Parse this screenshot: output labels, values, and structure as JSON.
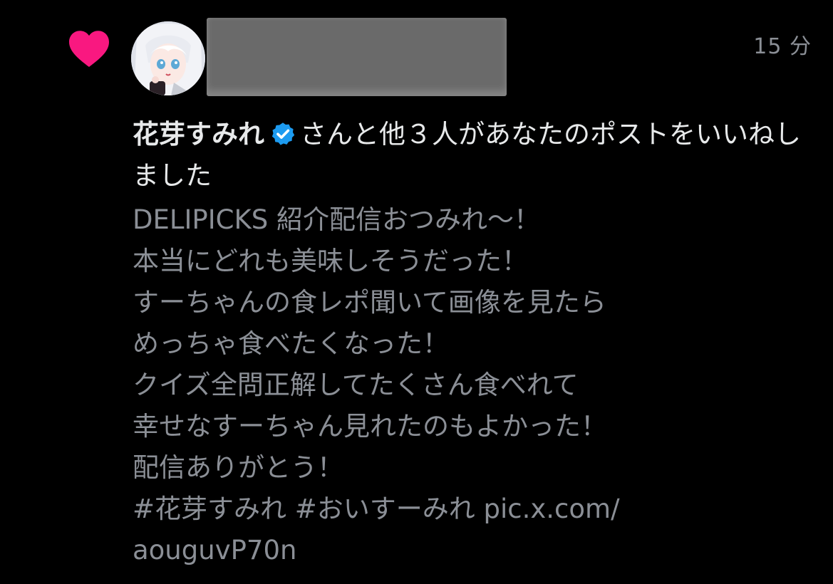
{
  "notification": {
    "time": "15 分",
    "user_name": "花芽すみれ",
    "action_text": "さんと他３人があなたのポストをいいねしました",
    "icons": {
      "like": "heart-icon",
      "verified": "verified-badge-icon"
    },
    "colors": {
      "heart": "#f91880",
      "verified": "#1d9bf0",
      "primary_text": "#e7e9ea",
      "secondary_text": "#8b8f96",
      "background": "#000000",
      "redaction": "#6a6a6a"
    }
  },
  "post": {
    "lines": [
      "DELIPICKS 紹介配信おつみれ〜！",
      "本当にどれも美味しそうだった！",
      "すーちゃんの食レポ聞いて画像を見たら",
      "めっちゃ食べたくなった！",
      "クイズ全問正解してたくさん食べれて",
      "幸せなすーちゃん見れたのもよかった！",
      "配信ありがとう！",
      "#花芽すみれ #おいすーみれ pic.x.com/",
      "aouguvP70n"
    ]
  }
}
